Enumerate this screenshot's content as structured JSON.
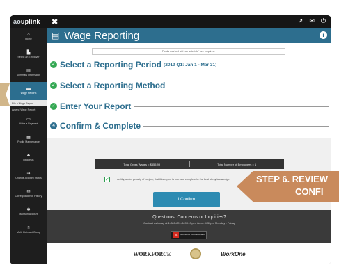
{
  "app": {
    "logo_prefix": "ao",
    "logo_main": "uplink"
  },
  "topbar": {
    "close": "✖",
    "icons": [
      "↗",
      "✉",
      "⏻"
    ]
  },
  "sidebar": {
    "items": [
      {
        "icon": "⌂",
        "label": "Home"
      },
      {
        "icon": "▙",
        "label": "Select an Employer"
      },
      {
        "icon": "▤",
        "label": "Summary Information"
      },
      {
        "icon": "▬",
        "label": "Wage Reports"
      }
    ],
    "subitems": [
      "File a Wage Report",
      "Amend Wage Report"
    ],
    "items2": [
      {
        "icon": "▭",
        "label": "Make a Payment"
      },
      {
        "icon": "▦",
        "label": "Profile Maintenance"
      },
      {
        "icon": "♣",
        "label": "Requests"
      },
      {
        "icon": "➔",
        "label": "Change Account Status"
      },
      {
        "icon": "✉",
        "label": "Correspondence History"
      },
      {
        "icon": "✱",
        "label": "Maintain Account"
      },
      {
        "icon": "▯",
        "label": "Multi Claimant Group"
      }
    ]
  },
  "header": {
    "title": "Wage Reporting",
    "info": "i"
  },
  "notice": "Fields marked with an asterisk * are required.",
  "steps": {
    "s1": {
      "label": "Select a Reporting Period",
      "sub": "(2019 Q1: Jan 1 - Mar 31)"
    },
    "s2": {
      "label": "Select a Reporting Method"
    },
    "s3": {
      "label": "Enter Your Report"
    },
    "s4": {
      "num": "4",
      "label": "Confirm & Complete"
    }
  },
  "totals": {
    "wages": "Total Gross Wages = $555.99",
    "employees": "Total Number of Employees = 1"
  },
  "certify": "I certify, under penalty of perjury, that this report is true and complete to the best of my knowledge.",
  "confirm_label": "I Confirm",
  "footer": {
    "question": "Questions, Concerns or Inquiries?",
    "contact": "Contact us today at 1-800-891-6499. Open 8am - 4:30pm Monday - Friday",
    "adobe": "Get Adobe Acrobat Reader"
  },
  "logos": {
    "workforce": "WORKFORCE",
    "workone": "WorkOne"
  },
  "callout": {
    "line1": "STEP 6. REVIEW",
    "line2": "CONFI"
  },
  "colors": {
    "brand": "#2d6e8e",
    "success": "#34a853",
    "callout": "#c98a5c"
  }
}
